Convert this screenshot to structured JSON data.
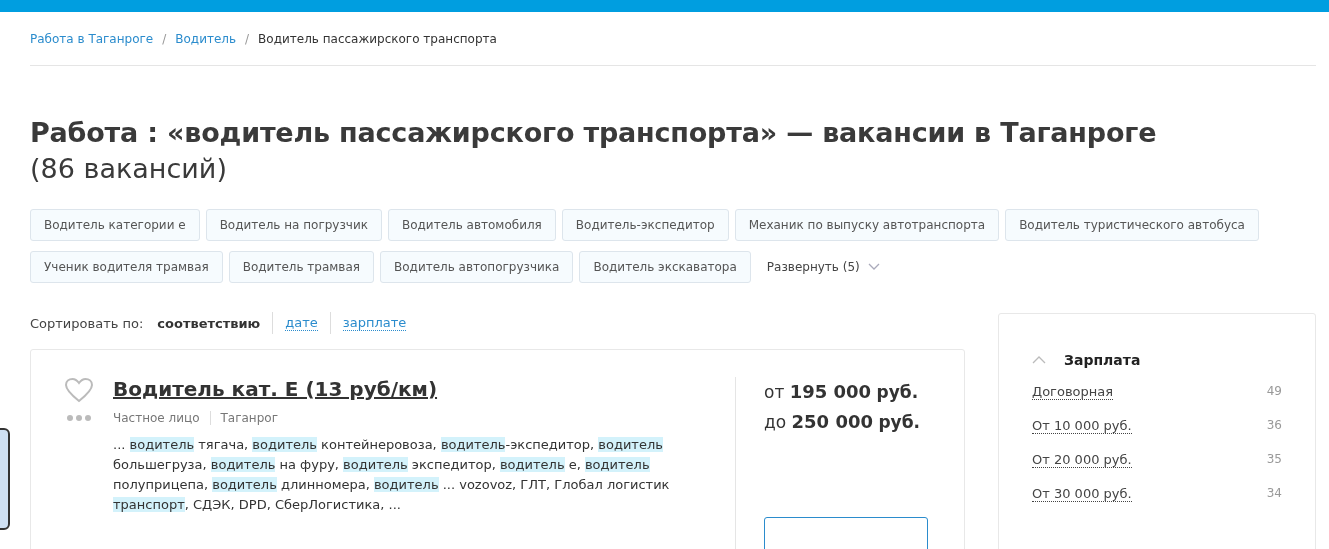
{
  "breadcrumbs": [
    {
      "label": "Работа в Таганроге",
      "link": true
    },
    {
      "label": "Водитель",
      "link": true
    },
    {
      "label": "Водитель пассажирского транспорта",
      "link": false
    }
  ],
  "breadcrumb_separator": "/",
  "heading": {
    "title": "Работа : «водитель пассажирского транспорта» — вакансии в Таганроге",
    "count": "(86 вакансий)"
  },
  "tags": [
    "Водитель категории е",
    "Водитель на погрузчик",
    "Водитель автомобиля",
    "Водитель-экспедитор",
    "Механик по выпуску автотранспорта",
    "Водитель туристического автобуса",
    "Ученик водителя трамвая",
    "Водитель трамвая",
    "Водитель автопогрузчика",
    "Водитель экскаватора"
  ],
  "expand_link": "Развернуть (5)",
  "sort": {
    "label": "Сортировать по:",
    "options": [
      {
        "label": "соответствию",
        "selected": true
      },
      {
        "label": "дате",
        "selected": false
      },
      {
        "label": "зарплате",
        "selected": false
      }
    ]
  },
  "vacancy": {
    "title": "Водитель кат. Е (13 руб/км)",
    "favorite": false,
    "employer": "Частное лицо",
    "city": "Таганрог",
    "snippet": [
      {
        "text": "... ",
        "highlight": false
      },
      {
        "text": "водитель",
        "highlight": true
      },
      {
        "text": " тягача, ",
        "highlight": false
      },
      {
        "text": "водитель",
        "highlight": true
      },
      {
        "text": " контейнеровоза, ",
        "highlight": false
      },
      {
        "text": "водитель",
        "highlight": true
      },
      {
        "text": "-экспедитор, ",
        "highlight": false
      },
      {
        "text": "водитель",
        "highlight": true
      },
      {
        "text": " большегруза, ",
        "highlight": false
      },
      {
        "text": "водитель",
        "highlight": true
      },
      {
        "text": " на фуру, ",
        "highlight": false
      },
      {
        "text": "водитель",
        "highlight": true
      },
      {
        "text": " экспедитор, ",
        "highlight": false
      },
      {
        "text": "водитель",
        "highlight": true
      },
      {
        "text": " е, ",
        "highlight": false
      },
      {
        "text": "водитель",
        "highlight": true
      },
      {
        "text": " полуприцепа, ",
        "highlight": false
      },
      {
        "text": "водитель",
        "highlight": true
      },
      {
        "text": " длинномера, ",
        "highlight": false
      },
      {
        "text": "водитель",
        "highlight": true
      },
      {
        "text": " ... vozovoz, ГЛТ, Глобал логистик ",
        "highlight": false
      },
      {
        "text": "транспорт",
        "highlight": true
      },
      {
        "text": ", СДЭК, DPD, СберЛогистика, ...",
        "highlight": false
      }
    ],
    "salary": [
      {
        "prefix": "от",
        "amount": "195 000",
        "currency": "руб."
      },
      {
        "prefix": "до",
        "amount": "250 000",
        "currency": "руб."
      }
    ]
  },
  "filter": {
    "title": "Зарплата",
    "expanded": true,
    "items": [
      {
        "label": "Договорная",
        "count": "49"
      },
      {
        "label": "От 10 000 руб.",
        "count": "36"
      },
      {
        "label": "От 20 000 руб.",
        "count": "35"
      },
      {
        "label": "От 30 000 руб.",
        "count": "34"
      }
    ]
  }
}
